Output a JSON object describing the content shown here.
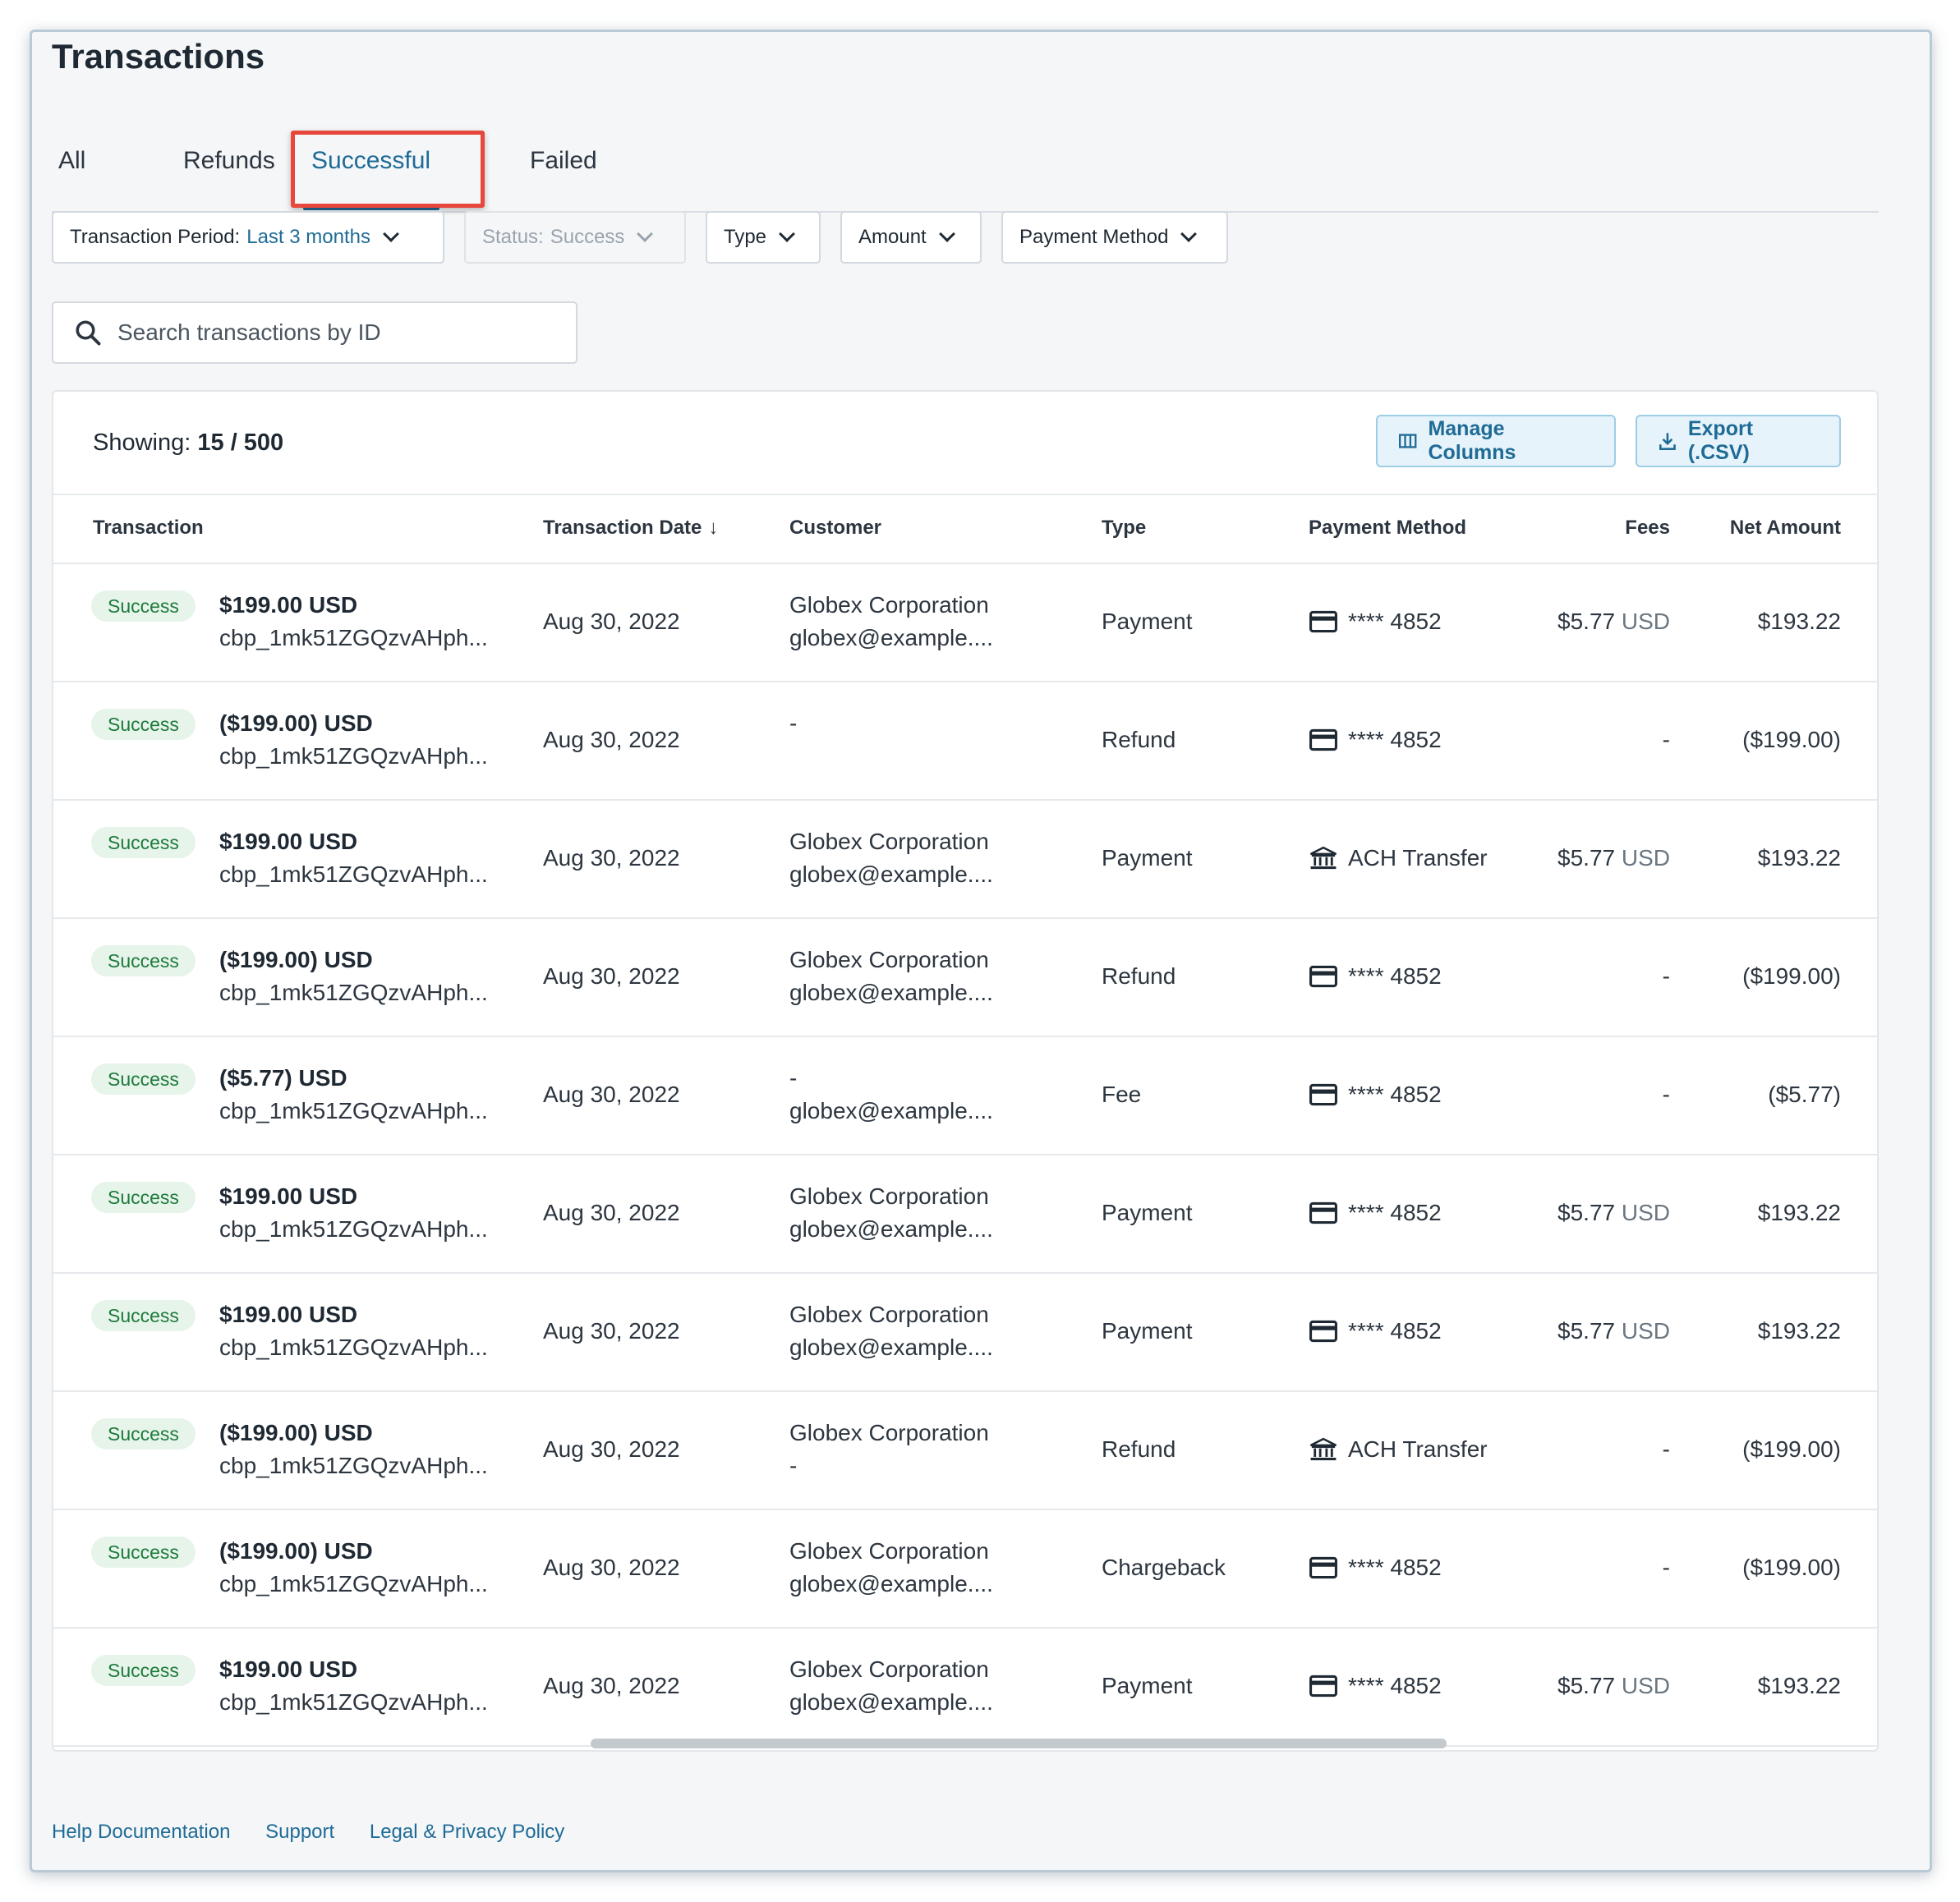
{
  "page": {
    "title": "Transactions"
  },
  "tabs": [
    {
      "label": "All"
    },
    {
      "label": "Refunds"
    },
    {
      "label": "Successful"
    },
    {
      "label": "Failed"
    }
  ],
  "filters": {
    "period_label": "Transaction Period:",
    "period_value": "Last 3 months",
    "status_label": "Status:",
    "status_value": "Success",
    "type_label": "Type",
    "amount_label": "Amount",
    "payment_method_label": "Payment Method"
  },
  "search": {
    "placeholder": "Search transactions by ID"
  },
  "summary": {
    "showing_label": "Showing:",
    "showing_value": "15 / 500"
  },
  "actions": {
    "manage_columns": "Manage Columns",
    "export": "Export (.CSV)"
  },
  "columns": {
    "transaction": "Transaction",
    "date": "Transaction Date",
    "date_sort": "↓",
    "customer": "Customer",
    "type": "Type",
    "payment_method": "Payment Method",
    "fees": "Fees",
    "net": "Net Amount"
  },
  "rows": [
    {
      "status": "Success",
      "amount": "$199.00 USD",
      "txid": "cbp_1mk51ZGQzvAHph...",
      "date": "Aug 30, 2022",
      "customer_name": "Globex Corporation",
      "customer_email": "globex@example....",
      "type": "Payment",
      "pm_icon": "card-icon",
      "pm": "**** 4852",
      "fee": "$5.77",
      "fee_cur": "USD",
      "net": "$193.22"
    },
    {
      "status": "Success",
      "amount": "($199.00) USD",
      "txid": "cbp_1mk51ZGQzvAHph...",
      "date": "Aug 30, 2022",
      "customer_name": "-",
      "customer_email": "",
      "type": "Refund",
      "pm_icon": "card-icon",
      "pm": "**** 4852",
      "fee": "-",
      "fee_cur": "",
      "net": "($199.00)"
    },
    {
      "status": "Success",
      "amount": "$199.00 USD",
      "txid": "cbp_1mk51ZGQzvAHph...",
      "date": "Aug 30, 2022",
      "customer_name": "Globex Corporation",
      "customer_email": "globex@example....",
      "type": "Payment",
      "pm_icon": "bank-icon",
      "pm": "ACH Transfer",
      "fee": "$5.77",
      "fee_cur": "USD",
      "net": "$193.22"
    },
    {
      "status": "Success",
      "amount": "($199.00) USD",
      "txid": "cbp_1mk51ZGQzvAHph...",
      "date": "Aug 30, 2022",
      "customer_name": "Globex Corporation",
      "customer_email": "globex@example....",
      "type": "Refund",
      "pm_icon": "card-icon",
      "pm": "**** 4852",
      "fee": "-",
      "fee_cur": "",
      "net": "($199.00)"
    },
    {
      "status": "Success",
      "amount": "($5.77) USD",
      "txid": "cbp_1mk51ZGQzvAHph...",
      "date": "Aug 30, 2022",
      "customer_name": "-",
      "customer_email": "globex@example....",
      "type": "Fee",
      "pm_icon": "card-icon",
      "pm": "**** 4852",
      "fee": "-",
      "fee_cur": "",
      "net": "($5.77)"
    },
    {
      "status": "Success",
      "amount": "$199.00 USD",
      "txid": "cbp_1mk51ZGQzvAHph...",
      "date": "Aug 30, 2022",
      "customer_name": "Globex Corporation",
      "customer_email": "globex@example....",
      "type": "Payment",
      "pm_icon": "card-icon",
      "pm": "**** 4852",
      "fee": "$5.77",
      "fee_cur": "USD",
      "net": "$193.22"
    },
    {
      "status": "Success",
      "amount": "$199.00 USD",
      "txid": "cbp_1mk51ZGQzvAHph...",
      "date": "Aug 30, 2022",
      "customer_name": "Globex Corporation",
      "customer_email": "globex@example....",
      "type": "Payment",
      "pm_icon": "card-icon",
      "pm": "**** 4852",
      "fee": "$5.77",
      "fee_cur": "USD",
      "net": "$193.22"
    },
    {
      "status": "Success",
      "amount": "($199.00) USD",
      "txid": "cbp_1mk51ZGQzvAHph...",
      "date": "Aug 30, 2022",
      "customer_name": "Globex Corporation",
      "customer_email": "-",
      "type": "Refund",
      "pm_icon": "bank-icon",
      "pm": "ACH Transfer",
      "fee": "-",
      "fee_cur": "",
      "net": "($199.00)"
    },
    {
      "status": "Success",
      "amount": "($199.00) USD",
      "txid": "cbp_1mk51ZGQzvAHph...",
      "date": "Aug 30, 2022",
      "customer_name": "Globex Corporation",
      "customer_email": "globex@example....",
      "type": "Chargeback",
      "pm_icon": "card-icon",
      "pm": "**** 4852",
      "fee": "-",
      "fee_cur": "",
      "net": "($199.00)"
    },
    {
      "status": "Success",
      "amount": "$199.00 USD",
      "txid": "cbp_1mk51ZGQzvAHph...",
      "date": "Aug 30, 2022",
      "customer_name": "Globex Corporation",
      "customer_email": "globex@example....",
      "type": "Payment",
      "pm_icon": "card-icon",
      "pm": "**** 4852",
      "fee": "$5.77",
      "fee_cur": "USD",
      "net": "$193.22"
    }
  ],
  "footer": {
    "help": "Help Documentation",
    "support": "Support",
    "legal": "Legal & Privacy Policy"
  },
  "colors": {
    "accent": "#1f6b96",
    "success_bg": "#e6f4ea",
    "success_text": "#1e7a3c",
    "highlight": "#e8473c"
  }
}
